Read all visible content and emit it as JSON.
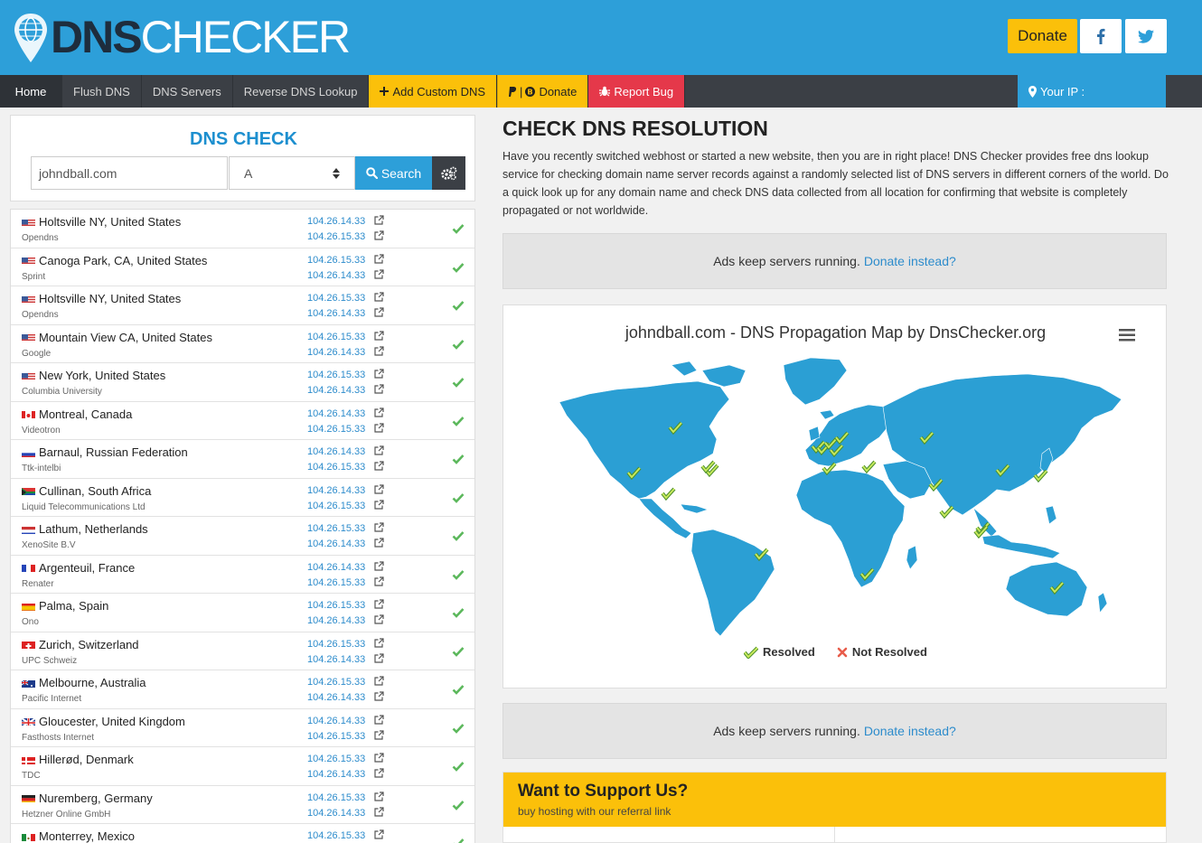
{
  "header": {
    "logo_bold": "DNS",
    "logo_light": "CHECKER",
    "donate_label": "Donate"
  },
  "nav": {
    "home": "Home",
    "flush": "Flush DNS",
    "servers": "DNS Servers",
    "reverse": "Reverse DNS Lookup",
    "custom": "Add Custom DNS",
    "donate": "Donate",
    "bug": "Report Bug",
    "ip": "Your IP :"
  },
  "dns_check": {
    "title": "DNS CHECK",
    "domain_value": "johndball.com",
    "record_type": "A",
    "search_label": "Search"
  },
  "results": [
    {
      "location": "Holtsville NY, United States",
      "provider": "Opendns",
      "ip1": "104.26.14.33",
      "ip2": "104.26.15.33",
      "flag": "us"
    },
    {
      "location": "Canoga Park, CA, United States",
      "provider": "Sprint",
      "ip1": "104.26.15.33",
      "ip2": "104.26.14.33",
      "flag": "us"
    },
    {
      "location": "Holtsville NY, United States",
      "provider": "Opendns",
      "ip1": "104.26.15.33",
      "ip2": "104.26.14.33",
      "flag": "us"
    },
    {
      "location": "Mountain View CA, United States",
      "provider": "Google",
      "ip1": "104.26.15.33",
      "ip2": "104.26.14.33",
      "flag": "us"
    },
    {
      "location": "New York, United States",
      "provider": "Columbia University",
      "ip1": "104.26.15.33",
      "ip2": "104.26.14.33",
      "flag": "us"
    },
    {
      "location": "Montreal, Canada",
      "provider": "Videotron",
      "ip1": "104.26.14.33",
      "ip2": "104.26.15.33",
      "flag": "ca"
    },
    {
      "location": "Barnaul, Russian Federation",
      "provider": "Ttk-intelbi",
      "ip1": "104.26.14.33",
      "ip2": "104.26.15.33",
      "flag": "ru"
    },
    {
      "location": "Cullinan, South Africa",
      "provider": "Liquid Telecommunications Ltd",
      "ip1": "104.26.14.33",
      "ip2": "104.26.15.33",
      "flag": "za"
    },
    {
      "location": "Lathum, Netherlands",
      "provider": "XenoSite B.V",
      "ip1": "104.26.15.33",
      "ip2": "104.26.14.33",
      "flag": "nl"
    },
    {
      "location": "Argenteuil, France",
      "provider": "Renater",
      "ip1": "104.26.14.33",
      "ip2": "104.26.15.33",
      "flag": "fr"
    },
    {
      "location": "Palma, Spain",
      "provider": "Ono",
      "ip1": "104.26.15.33",
      "ip2": "104.26.14.33",
      "flag": "es"
    },
    {
      "location": "Zurich, Switzerland",
      "provider": "UPC Schweiz",
      "ip1": "104.26.15.33",
      "ip2": "104.26.14.33",
      "flag": "ch"
    },
    {
      "location": "Melbourne, Australia",
      "provider": "Pacific Internet",
      "ip1": "104.26.15.33",
      "ip2": "104.26.14.33",
      "flag": "au"
    },
    {
      "location": "Gloucester, United Kingdom",
      "provider": "Fasthosts Internet",
      "ip1": "104.26.14.33",
      "ip2": "104.26.15.33",
      "flag": "gb"
    },
    {
      "location": "Hillerød, Denmark",
      "provider": "TDC",
      "ip1": "104.26.15.33",
      "ip2": "104.26.14.33",
      "flag": "dk"
    },
    {
      "location": "Nuremberg, Germany",
      "provider": "Hetzner Online GmbH",
      "ip1": "104.26.15.33",
      "ip2": "104.26.14.33",
      "flag": "de"
    },
    {
      "location": "Monterrey, Mexico",
      "provider": "",
      "ip1": "104.26.15.33",
      "ip2": "",
      "flag": "mx"
    }
  ],
  "main": {
    "title": "CHECK DNS RESOLUTION",
    "description": "Have you recently switched webhost or started a new website, then you are in right place! DNS Checker provides free dns lookup service for checking domain name server records against a randomly selected list of DNS servers in different corners of the world. Do a quick look up for any domain name and check DNS data collected from all location for confirming that website is completely propagated or not worldwide."
  },
  "ads": {
    "text": "Ads keep servers running.",
    "link": "Donate instead?"
  },
  "map": {
    "title": "johndball.com - DNS Propagation Map by DnsChecker.org",
    "legend_resolved": "Resolved",
    "legend_not_resolved": "Not Resolved"
  },
  "support": {
    "title": "Want to Support Us?",
    "subtitle": "buy hosting with our referral link"
  },
  "colors": {
    "brand_blue": "#2d9fd9",
    "accent_yellow": "#fbc00a",
    "bug_red": "#e5384a",
    "nav_dark": "#3b3f45",
    "resolved_green": "#5cb85c",
    "map_land": "#2b9fd4"
  }
}
